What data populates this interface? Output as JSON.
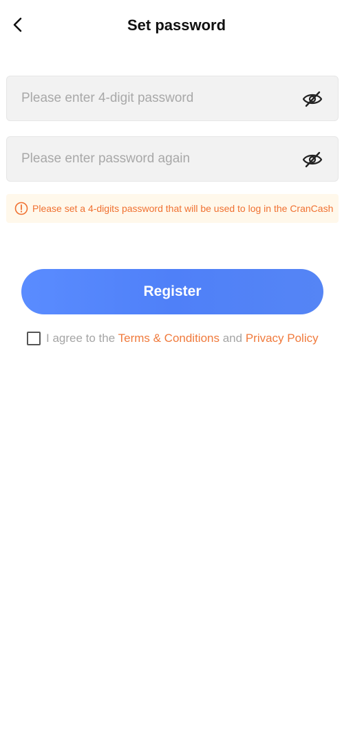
{
  "header": {
    "title": "Set password",
    "back_icon": "chevron-left-icon"
  },
  "password_field": {
    "placeholder": "Please enter 4-digit password",
    "value": "",
    "toggle_icon": "eye-hidden-icon"
  },
  "confirm_field": {
    "placeholder": "Please enter password again",
    "value": "",
    "toggle_icon": "eye-hidden-icon"
  },
  "notice": {
    "text": "Please set a 4-digits password that will be used to log in the CranCash",
    "icon": "warning-circle-icon",
    "color": "#f07030",
    "background": "#fff8eb"
  },
  "register_button": {
    "label": "Register",
    "color": "#5a8cff"
  },
  "agreement": {
    "checked": false,
    "prefix": "I agree to the ",
    "terms_link": "Terms & Conditions",
    "conjunction": " and ",
    "privacy_link": "Privacy Policy",
    "link_color": "#f07a3c"
  }
}
